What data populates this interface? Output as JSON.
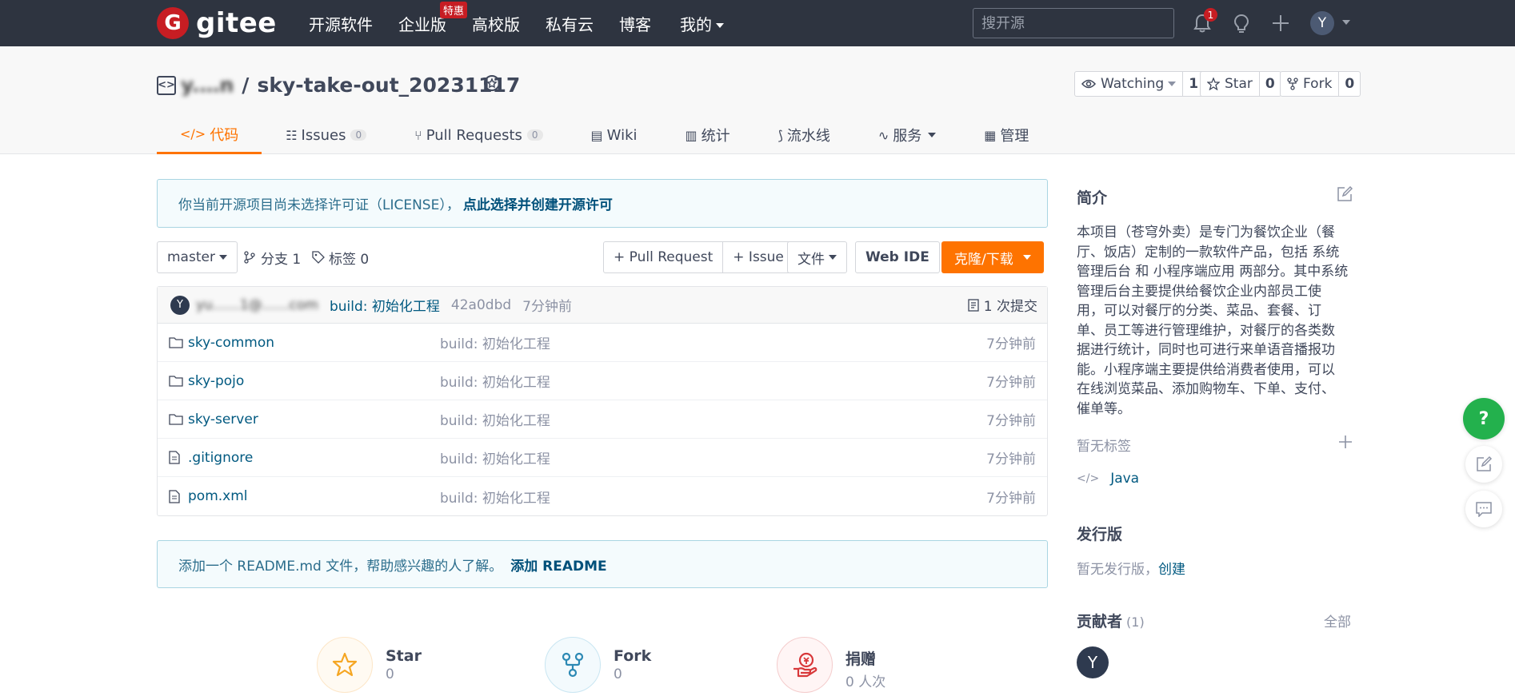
{
  "topnav": {
    "logo_text": "gitee",
    "logo_letter": "G",
    "menu": [
      {
        "label": "开源软件"
      },
      {
        "label": "企业版",
        "badge": "特惠"
      },
      {
        "label": "高校版"
      },
      {
        "label": "私有云"
      },
      {
        "label": "博客"
      },
      {
        "label": "我的"
      }
    ],
    "search_placeholder": "搜开源",
    "notif_count": "1",
    "avatar_letter": "Y"
  },
  "repo": {
    "owner": "y.…n",
    "separator": "/",
    "name": "sky-take-out_20231117",
    "watch_label": "Watching",
    "watch_count": "1",
    "star_label": "Star",
    "star_count": "0",
    "fork_label": "Fork",
    "fork_count": "0"
  },
  "tabs": [
    {
      "label": "代码",
      "icon": "code-icon"
    },
    {
      "label": "Issues",
      "count": "0",
      "icon": "issues-icon"
    },
    {
      "label": "Pull Requests",
      "count": "0",
      "icon": "pull-request-icon"
    },
    {
      "label": "Wiki",
      "icon": "wiki-icon"
    },
    {
      "label": "统计",
      "icon": "stats-icon"
    },
    {
      "label": "流水线",
      "icon": "pipeline-icon"
    },
    {
      "label": "服务",
      "icon": "service-icon"
    },
    {
      "label": "管理",
      "icon": "manage-icon"
    }
  ],
  "license_notice": {
    "text": "你当前开源项目尚未选择许可证（LICENSE），",
    "link": "点此选择并创建开源许可"
  },
  "toolbar": {
    "branch": "master",
    "branches": "分支 1",
    "tags": "标签 0",
    "pull_request": "+ Pull Request",
    "issue": "+ Issue",
    "files": "文件",
    "web_ide": "Web IDE",
    "clone": "克隆/下载"
  },
  "commit": {
    "avatar": "Y",
    "author": "yu……1@……com",
    "message": "build: 初始化工程",
    "hash": "42a0dbd",
    "time": "7分钟前",
    "count": "1 次提交"
  },
  "files": [
    {
      "name": "sky-common",
      "type": "folder",
      "commit": "build: 初始化工程",
      "time": "7分钟前"
    },
    {
      "name": "sky-pojo",
      "type": "folder",
      "commit": "build: 初始化工程",
      "time": "7分钟前"
    },
    {
      "name": "sky-server",
      "type": "folder",
      "commit": "build: 初始化工程",
      "time": "7分钟前"
    },
    {
      "name": ".gitignore",
      "type": "file",
      "commit": "build: 初始化工程",
      "time": "7分钟前"
    },
    {
      "name": "pom.xml",
      "type": "file",
      "commit": "build: 初始化工程",
      "time": "7分钟前"
    }
  ],
  "readme_notice": {
    "text": "添加一个 README.md 文件，帮助感兴趣的人了解。",
    "link": "添加 README"
  },
  "stats": {
    "star_label": "Star",
    "star_value": "0",
    "fork_label": "Fork",
    "fork_value": "0",
    "donate_label": "捐赠",
    "donate_value": "0 人次"
  },
  "sidebar": {
    "intro_title": "简介",
    "intro_lines": [
      "本项目（苍穹外卖）是专门为餐饮企业（餐",
      "厅、饭店）定制的一款软件产品，包括 系统",
      "管理后台 和 小程序端应用 两部分。其中系统",
      "管理后台主要提供给餐饮企业内部员工使",
      "用，可以对餐厅的分类、菜品、套餐、订",
      "单、员工等进行管理维护，对餐厅的各类数",
      "据进行统计，同时也可进行来单语音播报功",
      "能。小程序端主要提供给消费者使用，可以",
      "在线浏览菜品、添加购物车、下单、支付、",
      "催单等。"
    ],
    "no_tags": "暂无标签",
    "language": "Java",
    "release_title": "发行版",
    "no_release": "暂无发行版，",
    "create_link": "创建",
    "contrib_title": "贡献者",
    "contrib_count": "(1)",
    "contrib_all": "全部",
    "contrib_avatar": "Y"
  },
  "floating": {
    "help": "?"
  },
  "colors": {
    "nav_bg": "#2e3440",
    "accent": "#fe7300",
    "brand_red": "#c71d23",
    "link": "#005980"
  }
}
